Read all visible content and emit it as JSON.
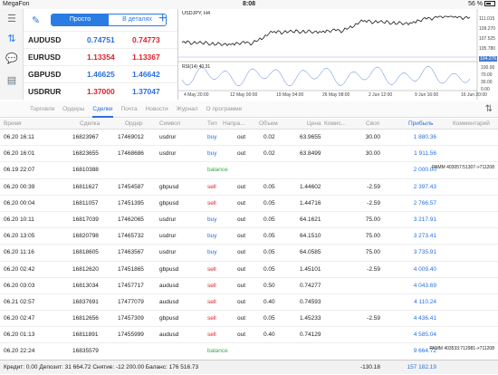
{
  "status": {
    "carrier": "MegaFon",
    "time": "8:08",
    "battery": "56 %"
  },
  "quotes": {
    "tab_simple": "Просто",
    "tab_detailed": "В деталях",
    "rows": [
      {
        "symbol": "AUDUSD",
        "bid": "0.74751",
        "ask": "0.74773",
        "bid_color": "blue",
        "ask_color": "red"
      },
      {
        "symbol": "EURUSD",
        "bid": "1.13354",
        "ask": "1.13367",
        "bid_color": "red",
        "ask_color": "red"
      },
      {
        "symbol": "GBPUSD",
        "bid": "1.46625",
        "ask": "1.46642",
        "bid_color": "blue",
        "ask_color": "blue"
      },
      {
        "symbol": "USDRUR",
        "bid": "1.37000",
        "ask": "1.37047",
        "bid_color": "red",
        "ask_color": "blue"
      }
    ]
  },
  "chart": {
    "title": "USDJPY, H4",
    "rsi_label": "RSI(14) 40.31",
    "price_ticks": [
      "111.015",
      "109.270",
      "107.525",
      "105.780",
      "104.276"
    ],
    "last_price": "104.276",
    "rsi_ticks": [
      "100.00",
      "70.00",
      "30.00",
      "0.00"
    ],
    "time_ticks": [
      "4 May 20:00",
      "12 May 00:00",
      "19 May 04:00",
      "26 May 08:00",
      "2 Jun 12:00",
      "9 Jun 16:00",
      "16 Jun 20:00"
    ]
  },
  "tabs": [
    "Торговля",
    "Ордеры",
    "Сделки",
    "Почта",
    "Новости",
    "Журнал",
    "О программе"
  ],
  "columns": {
    "time": "Время",
    "deal": "Сделка",
    "order": "Ордер",
    "symbol": "Символ",
    "type": "Тип",
    "dir": "Напра...",
    "volume": "Объем",
    "price": "Цена",
    "comm": "Комис...",
    "swap": "Своп",
    "profit": "Прибыль",
    "comment": "Комментарий"
  },
  "deals": [
    {
      "time": "06.20 16:11",
      "deal": "16823967",
      "order": "17469012",
      "symbol": "usdrur",
      "type": "buy",
      "dir": "out",
      "vol": "0.02",
      "price": "63.9655",
      "comm": "",
      "swap": "30.00",
      "profit": "1 880.36",
      "comment": ""
    },
    {
      "time": "06.20 16:01",
      "deal": "16823655",
      "order": "17468686",
      "symbol": "usdrur",
      "type": "buy",
      "dir": "out",
      "vol": "0.02",
      "price": "63.8499",
      "comm": "",
      "swap": "30.00",
      "profit": "1 911.56",
      "comment": ""
    },
    {
      "time": "06.19 22:07",
      "deal": "16810388",
      "order": "",
      "symbol": "",
      "type": "balance",
      "dir": "",
      "vol": "",
      "price": "",
      "comm": "",
      "swap": "",
      "profit": "2 000.00",
      "comment": "PAMM 403057:51307->711208"
    },
    {
      "time": "06.20 00:39",
      "deal": "16811627",
      "order": "17454587",
      "symbol": "gbpusd",
      "type": "sell",
      "dir": "out",
      "vol": "0.05",
      "price": "1.44602",
      "comm": "",
      "swap": "-2.59",
      "profit": "2 397.43",
      "comment": ""
    },
    {
      "time": "06.20 00:04",
      "deal": "16811057",
      "order": "17451395",
      "symbol": "gbpusd",
      "type": "sell",
      "dir": "out",
      "vol": "0.05",
      "price": "1.44716",
      "comm": "",
      "swap": "-2.59",
      "profit": "2 766.57",
      "comment": ""
    },
    {
      "time": "06.20 10:11",
      "deal": "16817039",
      "order": "17462065",
      "symbol": "usdrur",
      "type": "buy",
      "dir": "out",
      "vol": "0.05",
      "price": "64.1621",
      "comm": "",
      "swap": "75.00",
      "profit": "3 217.91",
      "comment": ""
    },
    {
      "time": "06.20 13:05",
      "deal": "16820798",
      "order": "17465732",
      "symbol": "usdrur",
      "type": "buy",
      "dir": "out",
      "vol": "0.05",
      "price": "64.1510",
      "comm": "",
      "swap": "75.00",
      "profit": "3 273.41",
      "comment": ""
    },
    {
      "time": "06.20 11:16",
      "deal": "16818605",
      "order": "17463567",
      "symbol": "usdrur",
      "type": "buy",
      "dir": "out",
      "vol": "0.05",
      "price": "64.0585",
      "comm": "",
      "swap": "75.00",
      "profit": "3 735.91",
      "comment": ""
    },
    {
      "time": "06.20 02:42",
      "deal": "16812620",
      "order": "17451865",
      "symbol": "gbpusd",
      "type": "sell",
      "dir": "out",
      "vol": "0.05",
      "price": "1.45101",
      "comm": "",
      "swap": "-2.59",
      "profit": "4 009.40",
      "comment": ""
    },
    {
      "time": "06.20 03:03",
      "deal": "16813034",
      "order": "17457717",
      "symbol": "audusd",
      "type": "sell",
      "dir": "out",
      "vol": "0.50",
      "price": "0.74277",
      "comm": "",
      "swap": "",
      "profit": "4 043.69",
      "comment": ""
    },
    {
      "time": "06.21 02:57",
      "deal": "16837691",
      "order": "17477079",
      "symbol": "audusd",
      "type": "sell",
      "dir": "out",
      "vol": "0.40",
      "price": "0.74593",
      "comm": "",
      "swap": "",
      "profit": "4 110.24",
      "comment": ""
    },
    {
      "time": "06.20 02:47",
      "deal": "16812656",
      "order": "17457309",
      "symbol": "gbpusd",
      "type": "sell",
      "dir": "out",
      "vol": "0.05",
      "price": "1.45233",
      "comm": "",
      "swap": "-2.59",
      "profit": "4 436.41",
      "comment": ""
    },
    {
      "time": "06.20 01:13",
      "deal": "16811891",
      "order": "17455999",
      "symbol": "audusd",
      "type": "sell",
      "dir": "out",
      "vol": "0.40",
      "price": "0.74129",
      "comm": "",
      "swap": "",
      "profit": "4 585.04",
      "comment": ""
    },
    {
      "time": "06.20 22:24",
      "deal": "16835579",
      "order": "",
      "symbol": "",
      "type": "balance",
      "dir": "",
      "vol": "",
      "price": "",
      "comm": "",
      "swap": "",
      "profit": "9 664.72",
      "comment": "PAMM 403533:712981->711208"
    },
    {
      "time": "06.20 22:24",
      "deal": "16835581",
      "order": "",
      "symbol": "",
      "type": "balance",
      "dir": "",
      "vol": "",
      "price": "",
      "comm": "",
      "swap": "",
      "profit": "20 000.00",
      "comment": "PAMM 404908:715486->711208"
    },
    {
      "time": "06.20 11:15",
      "deal": "16818579",
      "order": "17463545",
      "symbol": "gbpusd",
      "type": "sell",
      "dir": "out",
      "vol": "0.80",
      "price": "1.46065",
      "comm": "",
      "swap": "-41.40",
      "profit": "112 921.61",
      "comment": ""
    }
  ],
  "footer": {
    "summary": "Кредит: 0.00 Депозит: 31 664.72 Снятие: -12 200.00 Баланс: 176 516.73",
    "swap_total": "-130.18",
    "profit_total": "157 182.19"
  },
  "colors": {
    "accent": "#2a7be4",
    "buy": "#2a6fdb",
    "sell": "#e0202a",
    "balance": "#3aa84a"
  }
}
